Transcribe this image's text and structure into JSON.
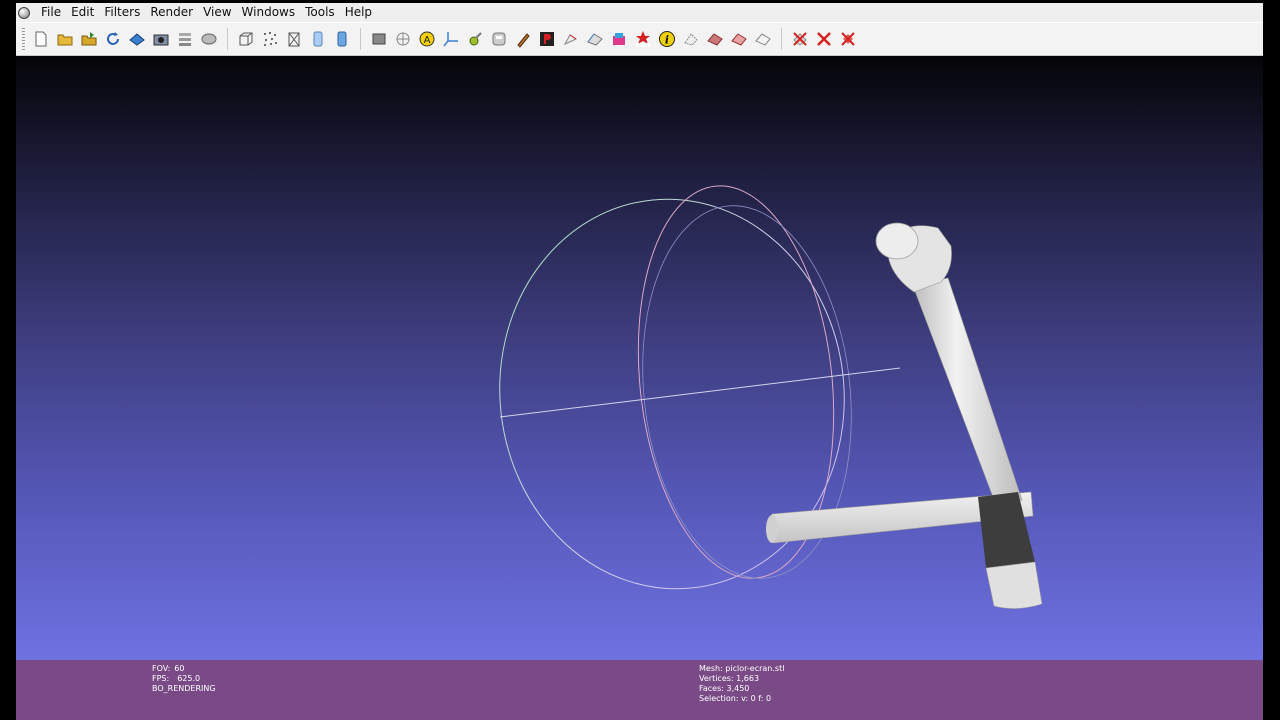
{
  "menu": {
    "items": [
      {
        "label": "File"
      },
      {
        "label": "Edit"
      },
      {
        "label": "Filters"
      },
      {
        "label": "Render"
      },
      {
        "label": "View"
      },
      {
        "label": "Windows"
      },
      {
        "label": "Tools"
      },
      {
        "label": "Help"
      }
    ]
  },
  "toolbar": {
    "icons": [
      "new-project-icon",
      "open-project-icon",
      "import-mesh-icon",
      "reload-icon",
      "export-mesh-icon",
      "snapshot-icon",
      "layers-icon",
      "options-icon",
      "bbox-icon",
      "points-icon",
      "wireframe-icon",
      "flat-shading-icon",
      "smooth-shading-icon",
      "lighting-icon",
      "trackball-icon",
      "annotation-icon",
      "axis-icon",
      "edit-tool-icon",
      "save-tool-icon",
      "paint-icon",
      "p-tool-icon",
      "select-vertices-icon",
      "select-faces-icon",
      "color-tool-icon",
      "secret-icon",
      "info-icon",
      "select-tool-1-icon",
      "select-tool-2-icon",
      "select-tool-3-icon",
      "select-tool-4-icon",
      "delete-faces-icon",
      "delete-vertices-icon",
      "delete-all-icon"
    ],
    "colors": {
      "red": "#d42020",
      "yellow": "#f3d000",
      "blue": "#3b7fd0"
    }
  },
  "info_left": {
    "fov_label": "FOV:",
    "fov_value": "60",
    "fps_label": "FPS:",
    "fps_value": "625.0",
    "rendering_mode": "BO_RENDERING"
  },
  "info_right": {
    "mesh": "Mesh: piclor-ecran.stl",
    "vertices": "Vertices: 1,663",
    "faces": "Faces: 3,450",
    "selection": "Selection: v: 0 f: 0"
  },
  "viewport": {
    "background_top": "#040407",
    "background_bottom": "#6f72e2",
    "mesh_color": "#d8d8d8"
  }
}
